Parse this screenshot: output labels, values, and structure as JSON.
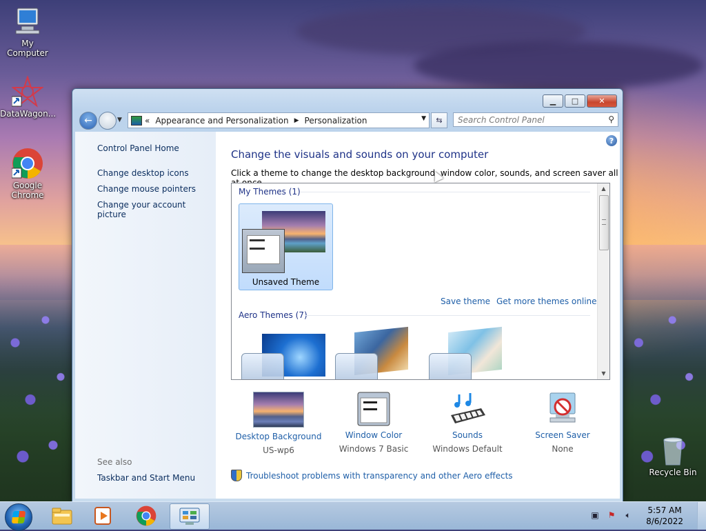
{
  "desktop": {
    "icons": [
      {
        "label": "My Computer"
      },
      {
        "label": "DataWagon..."
      },
      {
        "label": "Google Chrome"
      },
      {
        "label": "Recycle Bin"
      }
    ]
  },
  "window": {
    "address": {
      "prefix": "«",
      "segments": [
        "Appearance and Personalization",
        "Personalization"
      ]
    },
    "search": {
      "placeholder": "Search Control Panel"
    },
    "left_pane": {
      "home": "Control Panel Home",
      "links": [
        "Change desktop icons",
        "Change mouse pointers",
        "Change your account picture"
      ],
      "see_also": "See also",
      "see_also_links": [
        "Taskbar and Start Menu"
      ]
    },
    "main": {
      "heading": "Change the visuals and sounds on your computer",
      "subheading": "Click a theme to change the desktop background, window color, sounds, and screen saver all at once.",
      "my_themes": {
        "title": "My Themes (1)",
        "items": [
          {
            "label": "Unsaved Theme",
            "selected": true
          }
        ]
      },
      "save_theme": "Save theme",
      "get_more": "Get more themes online",
      "aero_themes": {
        "title": "Aero Themes (7)"
      },
      "bottom_items": [
        {
          "label": "Desktop Background",
          "value": "US-wp6"
        },
        {
          "label": "Window Color",
          "value": "Windows 7 Basic"
        },
        {
          "label": "Sounds",
          "value": "Windows Default"
        },
        {
          "label": "Screen Saver",
          "value": "None"
        }
      ],
      "troubleshoot": "Troubleshoot problems with transparency and other Aero effects"
    }
  },
  "taskbar": {
    "clock": {
      "time": "5:57 AM",
      "date": "8/6/2022"
    }
  },
  "colors": {
    "link": "#1f5fa8",
    "heading": "#1e3287"
  }
}
